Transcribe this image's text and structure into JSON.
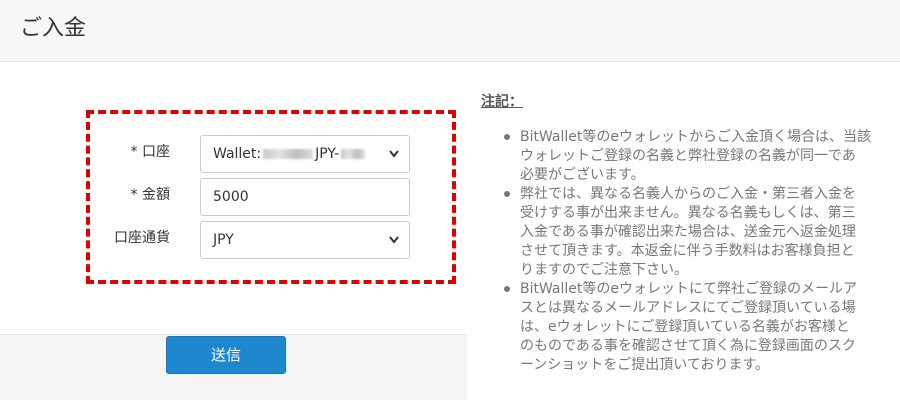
{
  "header": {
    "title": "ご入金"
  },
  "form": {
    "account": {
      "label": "* 口座",
      "value_prefix": "Wallet:",
      "value_mid": "JPY-"
    },
    "amount": {
      "label": "* 金額",
      "value": "5000"
    },
    "currency": {
      "label": "口座通貨",
      "value": "JPY"
    },
    "highlight_color": "#e00000"
  },
  "footer": {
    "submit_label": "送信",
    "submit_color": "#1e88cf"
  },
  "notes": {
    "title": "注記：",
    "items": [
      {
        "lines": [
          "BitWallet等のeウォレットからご入金頂く場合は、当該",
          "ウォレットご登録の名義と弊社登録の名義が同一であ",
          "必要がございます。"
        ]
      },
      {
        "lines": [
          "弊社では、異なる名義人からのご入金・第三者入金を",
          "受けする事が出来ません。異なる名義もしくは、第三",
          "入金である事が確認出来た場合は、送金元へ返金処理",
          "させて頂きます。本返金に伴う手数料はお客様負担と",
          "りますのでご注意下さい。"
        ]
      },
      {
        "lines": [
          "BitWallet等のeウォレットにて弊社ご登録のメールア",
          "スとは異なるメールアドレスにてご登録頂いている場",
          "は、eウォレットにご登録頂いている名義がお客様と",
          "のものである事を確認させて頂く為に登録画面のスク",
          "ーンショットをご提出頂いております。"
        ]
      }
    ]
  }
}
